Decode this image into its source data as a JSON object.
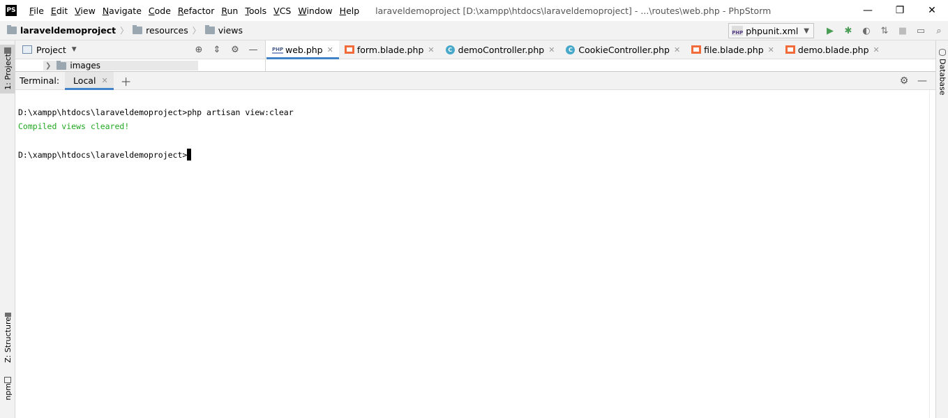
{
  "app": {
    "logo_text": "PS",
    "window_title": "laraveldemoproject [D:\\xampp\\htdocs\\laraveldemoproject] - ...\\routes\\web.php - PhpStorm"
  },
  "menu": [
    "File",
    "Edit",
    "View",
    "Navigate",
    "Code",
    "Refactor",
    "Run",
    "Tools",
    "VCS",
    "Window",
    "Help"
  ],
  "window_controls": {
    "minimize": "—",
    "restore": "❐",
    "close": "✕"
  },
  "breadcrumb": [
    "laraveldemoproject",
    "resources",
    "views"
  ],
  "run_config": {
    "label": "phpunit.xml",
    "icon": "php-file-icon"
  },
  "toolbar_icons": [
    "run-icon",
    "debug-icon",
    "coverage-icon",
    "profile-icon",
    "stop-icon",
    "window-icon",
    "search-icon"
  ],
  "left_tool_windows": {
    "project": "1: Project",
    "structure": "Z: Structure",
    "npm": "npm"
  },
  "right_tool_windows": {
    "database": "Database"
  },
  "project_panel": {
    "title": "Project",
    "tree_visible_item": "images"
  },
  "editor_tabs": [
    {
      "label": "web.php",
      "icon": "php",
      "active": true
    },
    {
      "label": "form.blade.php",
      "icon": "blade",
      "active": false
    },
    {
      "label": "demoController.php",
      "icon": "class",
      "active": false
    },
    {
      "label": "CookieController.php",
      "icon": "class",
      "active": false
    },
    {
      "label": "file.blade.php",
      "icon": "blade",
      "active": false
    },
    {
      "label": "demo.blade.php",
      "icon": "blade",
      "active": false
    }
  ],
  "terminal": {
    "label": "Terminal:",
    "active_tab": "Local",
    "lines": {
      "cmd1": "D:\\xampp\\htdocs\\laraveldemoproject>php artisan view:clear",
      "out1": "Compiled views cleared!",
      "prompt": "D:\\xampp\\htdocs\\laraveldemoproject>"
    },
    "colors": {
      "success": "#22a822"
    }
  },
  "colors": {
    "accent": "#4083c9",
    "run_green": "#499c54"
  }
}
